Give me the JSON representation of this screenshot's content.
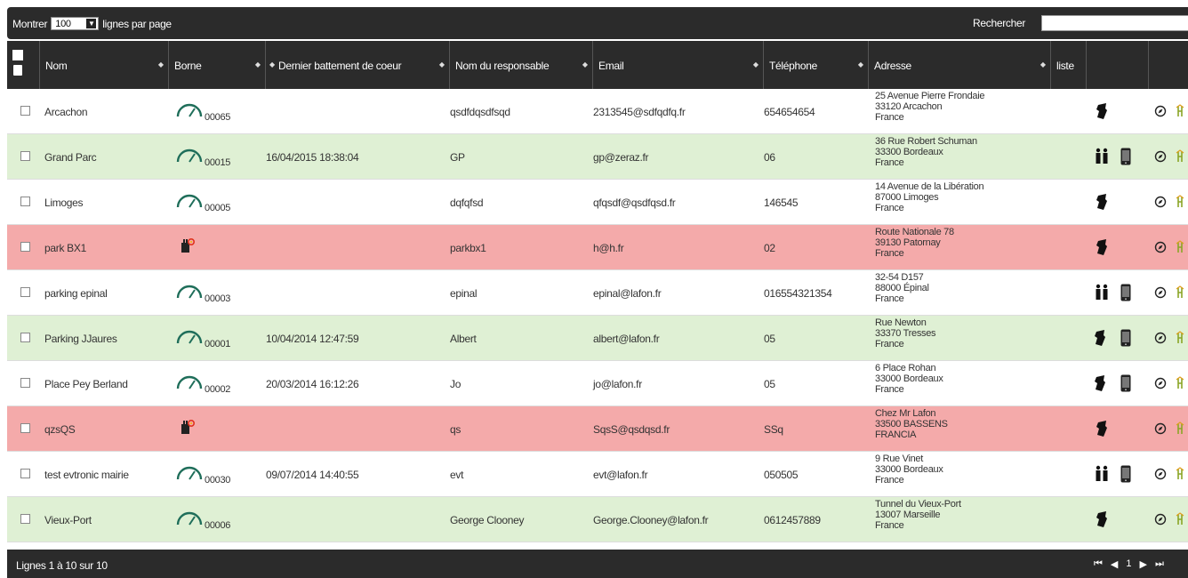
{
  "toolbar": {
    "show_prefix": "Montrer",
    "page_size": "100",
    "show_suffix": "lignes par page",
    "search_label": "Rechercher",
    "search_value": ""
  },
  "columns": [
    "Nom",
    "Borne",
    "Dernier battement de coeur",
    "Nom du responsable",
    "Email",
    "Téléphone",
    "Adresse",
    "liste"
  ],
  "rows": [
    {
      "status": "white",
      "nom": "Arcachon",
      "borne_type": "gauge",
      "borne_id": "00065",
      "heartbeat": "",
      "responsable": "qsdfdqsdfsqd",
      "email": "2313545@sdfqdfq.fr",
      "telephone": "654654654",
      "address": [
        "25 Avenue Pierre Frondaie",
        "33120 Arcachon",
        "France"
      ],
      "icons": [
        "plug-icon"
      ]
    },
    {
      "status": "green",
      "nom": "Grand Parc",
      "borne_type": "gauge",
      "borne_id": "00015",
      "heartbeat": "16/04/2015 18:38:04",
      "responsable": "GP",
      "email": "gp@zeraz.fr",
      "telephone": "06",
      "address": [
        "36 Rue Robert Schuman",
        "33300 Bordeaux",
        "France"
      ],
      "icons": [
        "people-icon",
        "phone-icon"
      ]
    },
    {
      "status": "white",
      "nom": "Limoges",
      "borne_type": "gauge",
      "borne_id": "00005",
      "heartbeat": "",
      "responsable": "dqfqfsd",
      "email": "qfqsdf@qsdfqsd.fr",
      "telephone": "146545",
      "address": [
        "14 Avenue de la Libération",
        "87000 Limoges",
        "France"
      ],
      "icons": [
        "plug-icon"
      ]
    },
    {
      "status": "red",
      "nom": "park BX1",
      "borne_type": "plug",
      "borne_id": "",
      "heartbeat": "",
      "responsable": "parkbx1",
      "email": "h@h.fr",
      "telephone": "02",
      "address": [
        "Route Nationale 78",
        "39130 Patornay",
        "France"
      ],
      "icons": [
        "plug-icon"
      ]
    },
    {
      "status": "white",
      "nom": "parking epinal",
      "borne_type": "gauge",
      "borne_id": "00003",
      "heartbeat": "",
      "responsable": "epinal",
      "email": "epinal@lafon.fr",
      "telephone": "016554321354",
      "address": [
        "32-54 D157",
        "88000 Épinal",
        "France"
      ],
      "icons": [
        "people-icon",
        "phone-icon"
      ]
    },
    {
      "status": "green",
      "nom": "Parking JJaures",
      "borne_type": "gauge",
      "borne_id": "00001",
      "heartbeat": "10/04/2014 12:47:59",
      "responsable": "Albert",
      "email": "albert@lafon.fr",
      "telephone": "05",
      "address": [
        "Rue Newton",
        "33370 Tresses",
        "France"
      ],
      "icons": [
        "plug-icon",
        "phone-icon"
      ]
    },
    {
      "status": "white",
      "nom": "Place Pey Berland",
      "borne_type": "gauge",
      "borne_id": "00002",
      "heartbeat": "20/03/2014 16:12:26",
      "responsable": "Jo",
      "email": "jo@lafon.fr",
      "telephone": "05",
      "address": [
        "6 Place Rohan",
        "33000 Bordeaux",
        "France"
      ],
      "icons": [
        "plug-icon",
        "phone-icon"
      ]
    },
    {
      "status": "red",
      "nom": "qzsQS",
      "borne_type": "plug",
      "borne_id": "",
      "heartbeat": "",
      "responsable": "qs",
      "email": "SqsS@qsdqsd.fr",
      "telephone": "SSq",
      "address": [
        "Chez Mr Lafon",
        "33500 BASSENS",
        "FRANCIA"
      ],
      "icons": [
        "plug-icon"
      ]
    },
    {
      "status": "white",
      "nom": "test evtronic mairie",
      "borne_type": "gauge",
      "borne_id": "00030",
      "heartbeat": "09/07/2014 14:40:55",
      "responsable": "evt",
      "email": "evt@lafon.fr",
      "telephone": "050505",
      "address": [
        "9 Rue Vinet",
        "33000 Bordeaux",
        "France"
      ],
      "icons": [
        "people-icon",
        "phone-icon"
      ]
    },
    {
      "status": "green",
      "nom": "Vieux-Port",
      "borne_type": "gauge",
      "borne_id": "00006",
      "heartbeat": "",
      "responsable": "George Clooney",
      "email": "George.Clooney@lafon.fr",
      "telephone": "0612457889",
      "address": [
        "Tunnel du Vieux-Port",
        "13007 Marseille",
        "France"
      ],
      "icons": [
        "plug-icon"
      ]
    }
  ],
  "footer": {
    "info": "Lignes 1 à 10 sur 10",
    "page": "1"
  },
  "colors": {
    "header_bg": "#2b2b2b",
    "row_green": "#dff0d4",
    "row_red": "#f4aaaa",
    "gauge": "#1f6e5a"
  }
}
